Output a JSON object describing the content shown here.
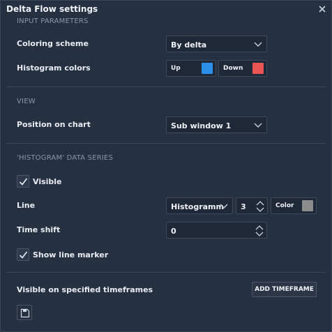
{
  "window": {
    "title": "Delta Flow settings"
  },
  "input_parameters": {
    "heading": "INPUT PARAMETERS",
    "coloring_scheme_label": "Coloring scheme",
    "coloring_scheme_value": "By delta",
    "histogram_colors_label": "Histogram colors",
    "up_label": "Up",
    "up_color": "#2b8fe8",
    "down_label": "Down",
    "down_color": "#ea5455"
  },
  "view": {
    "heading": "VIEW",
    "position_label": "Position on chart",
    "position_value": "Sub window 1"
  },
  "histogram_series": {
    "heading": "'HISTOGRAM' DATA SERIES",
    "visible_label": "Visible",
    "visible_checked": true,
    "line_label": "Line",
    "line_type_value": "Histogramm",
    "line_width_value": "3",
    "color_label": "Color",
    "line_color": "#8c8c8c",
    "time_shift_label": "Time shift",
    "time_shift_value": "0",
    "show_marker_label": "Show line marker",
    "show_marker_checked": true
  },
  "timeframes": {
    "label": "Visible on specified timeframes",
    "add_button": "ADD TIMEFRAME"
  },
  "footer": {
    "save_icon": "save-icon"
  }
}
